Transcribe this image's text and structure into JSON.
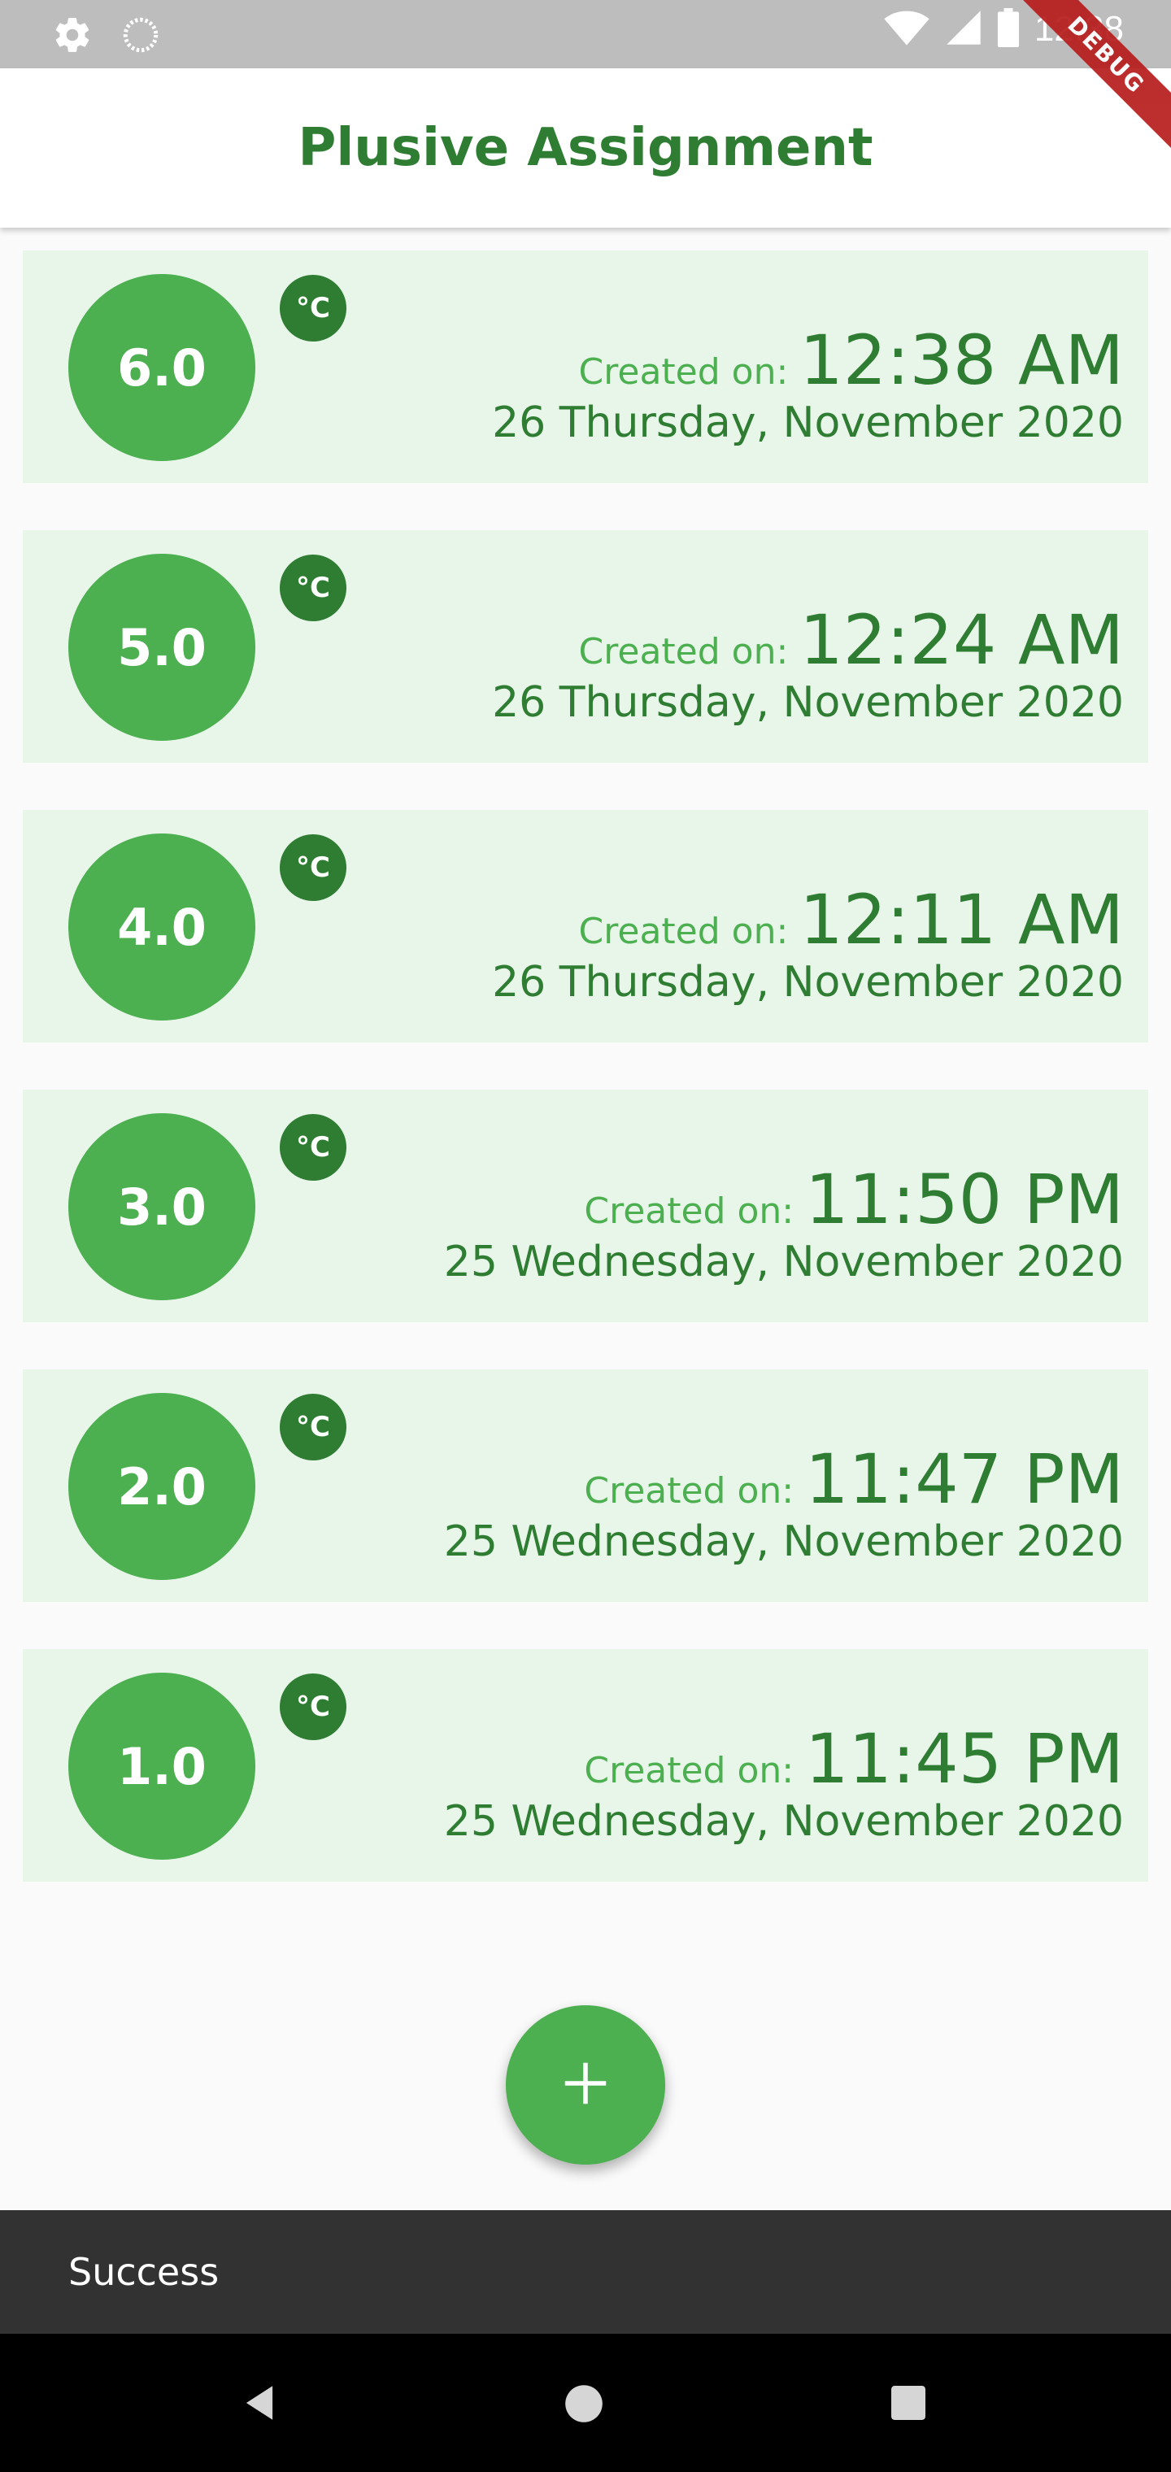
{
  "status_bar": {
    "time": "12:38"
  },
  "debug_label": "DEBUG",
  "app_bar": {
    "title": "Plusive Assignment"
  },
  "readings": [
    {
      "value": "6.0",
      "unit": "°C",
      "created_label": "Created on:",
      "time": "12:38 AM",
      "date": "26 Thursday, November 2020"
    },
    {
      "value": "5.0",
      "unit": "°C",
      "created_label": "Created on:",
      "time": "12:24 AM",
      "date": "26 Thursday, November 2020"
    },
    {
      "value": "4.0",
      "unit": "°C",
      "created_label": "Created on:",
      "time": "12:11 AM",
      "date": "26 Thursday, November 2020"
    },
    {
      "value": "3.0",
      "unit": "°C",
      "created_label": "Created on:",
      "time": "11:50 PM",
      "date": "25 Wednesday, November 2020"
    },
    {
      "value": "2.0",
      "unit": "°C",
      "created_label": "Created on:",
      "time": "11:47 PM",
      "date": "25 Wednesday, November 2020"
    },
    {
      "value": "1.0",
      "unit": "°C",
      "created_label": "Created on:",
      "time": "11:45 PM",
      "date": "25 Wednesday, November 2020"
    }
  ],
  "fab": {
    "icon": "plus-icon"
  },
  "snackbar": {
    "message": "Success"
  },
  "colors": {
    "primary": "#4caf50",
    "primary_dark": "#2e7d32",
    "card_background": "#e8f5e9",
    "snackbar_background": "#323232"
  }
}
